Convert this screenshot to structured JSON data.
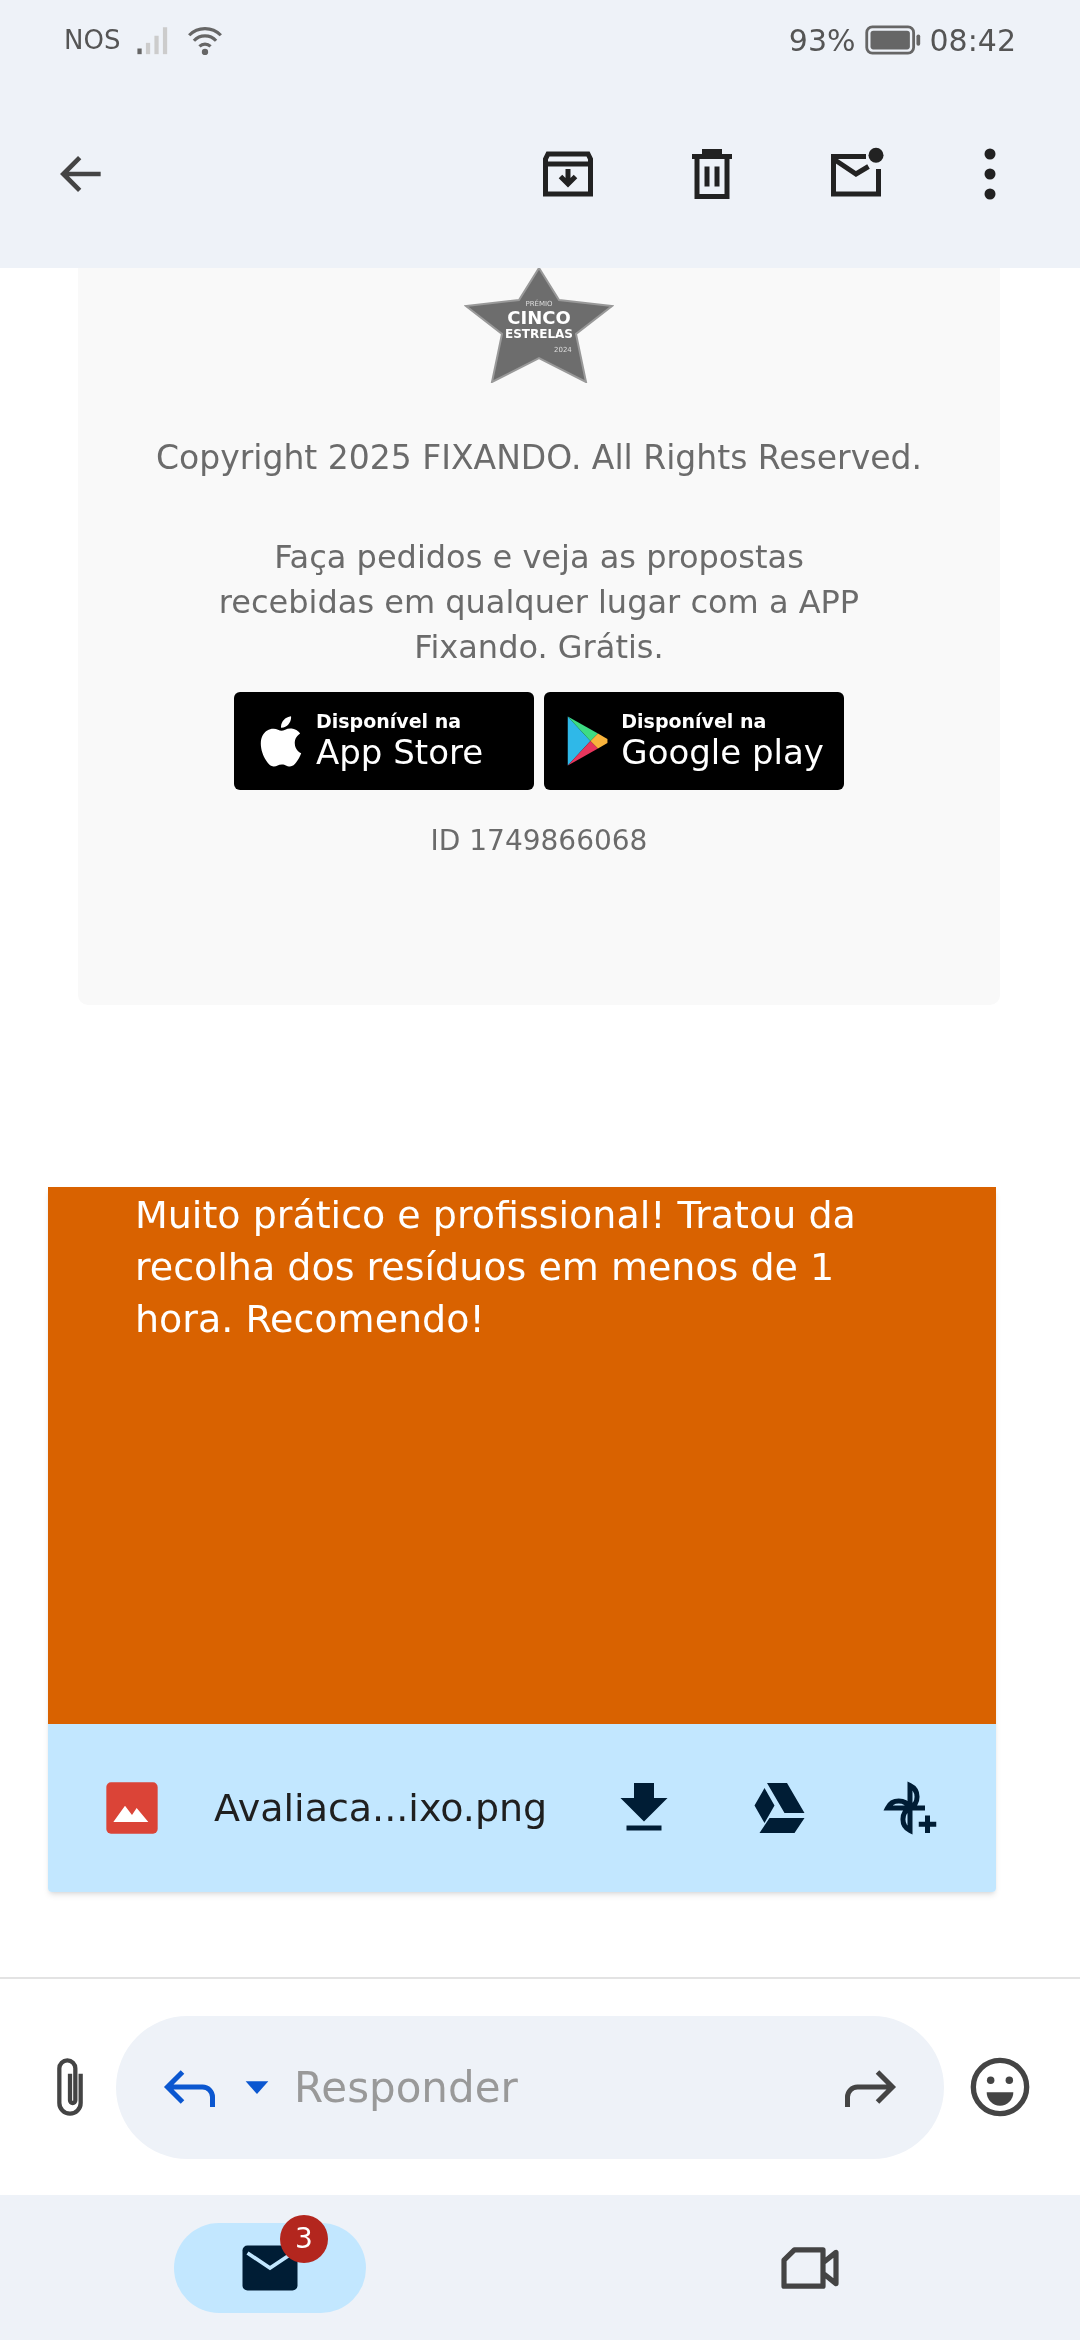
{
  "status_bar": {
    "carrier": "NOS",
    "battery": "93%",
    "time": "08:42"
  },
  "email": {
    "award_badge": {
      "line_1": "PRÉMIO",
      "line_2": "CINCO",
      "line_3": "ESTRELAS",
      "line_4": "2024"
    },
    "copyright": "Copyright 2025 FIXANDO. All Rights Reserved.",
    "app_promo": "Faça pedidos e veja as propostas recebidas em qualquer lugar com a APP Fixando. Grátis.",
    "store_buttons": [
      {
        "kind": "apple",
        "caption": "Disponível na",
        "name": "App Store"
      },
      {
        "kind": "google",
        "caption": "Disponível na",
        "name": "Google play"
      }
    ],
    "id": "ID 1749866068"
  },
  "attachment": {
    "preview_text": "Muito prático e profissional! Tratou da recolha dos resíduos em menos de 1 hora. Recomendo!",
    "file_name": "Avaliaca...ixo.png"
  },
  "reply_bar": {
    "placeholder": "Responder"
  },
  "bottom_nav": [
    {
      "kind": "mail",
      "selected": true,
      "badge": "3"
    },
    {
      "kind": "meet",
      "selected": false
    }
  ]
}
